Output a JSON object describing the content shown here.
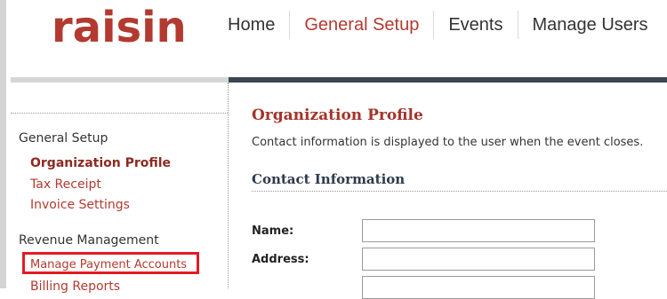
{
  "header": {
    "logo_text": "raisin",
    "nav": [
      {
        "label": "Home",
        "active": false
      },
      {
        "label": "General Setup",
        "active": true
      },
      {
        "label": "Events",
        "active": false
      },
      {
        "label": "Manage Users",
        "active": false
      }
    ]
  },
  "sidebar": {
    "sections": [
      {
        "heading": "General Setup",
        "items": [
          {
            "label": "Organization Profile",
            "active": true
          },
          {
            "label": "Tax Receipt",
            "active": false
          },
          {
            "label": "Invoice Settings",
            "active": false
          }
        ]
      },
      {
        "heading": "Revenue Management",
        "items": [
          {
            "label": "Manage Payment Accounts",
            "highlighted": true
          },
          {
            "label": "Billing Reports"
          }
        ]
      }
    ]
  },
  "main": {
    "title": "Organization Profile",
    "description": "Contact information is displayed to the user when the event closes.",
    "section_title": "Contact Information",
    "fields": [
      {
        "label": "Name:",
        "value": ""
      },
      {
        "label": "Address:",
        "value": ""
      },
      {
        "label": "",
        "value": ""
      }
    ]
  },
  "colors": {
    "brand": "#b33a30",
    "highlight": "#e31b23",
    "dark_bar": "#3b4652"
  }
}
